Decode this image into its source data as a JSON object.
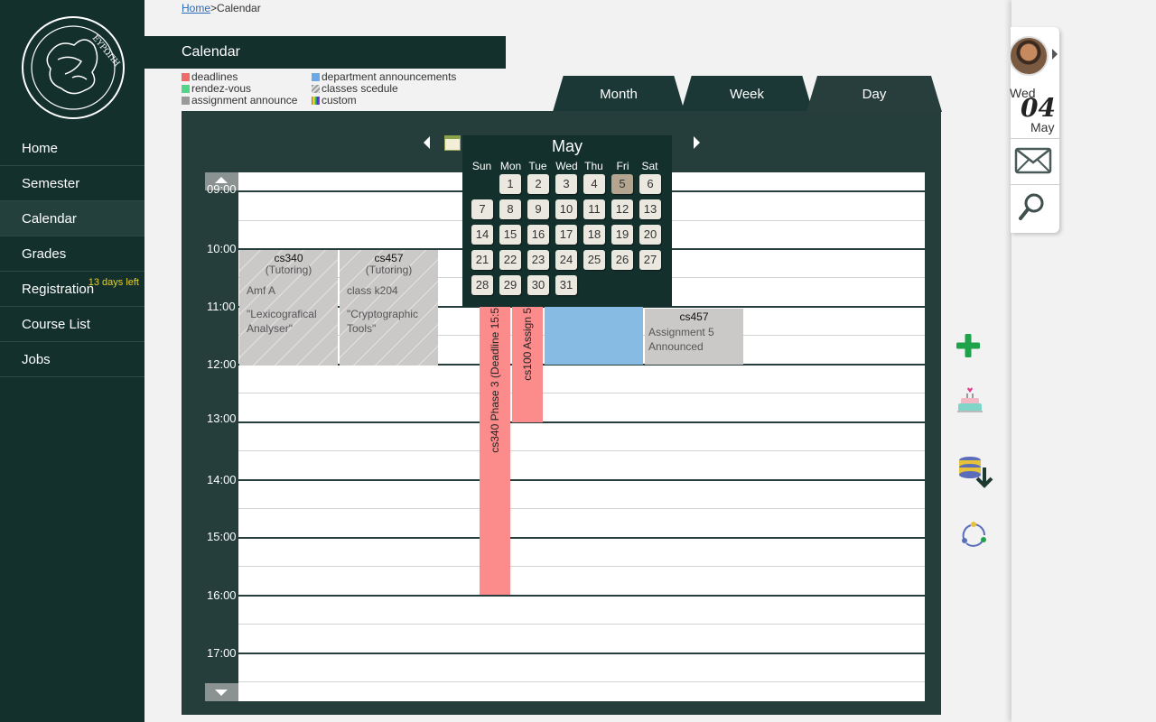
{
  "breadcrumb": {
    "home": "Home",
    "separator": ">",
    "current": "Calendar"
  },
  "logo": {
    "text": "ΕΥΡΩΠΗ"
  },
  "sidebar": {
    "items": [
      {
        "label": "Home"
      },
      {
        "label": "Semester"
      },
      {
        "label": "Calendar",
        "active": true
      },
      {
        "label": "Grades"
      },
      {
        "label": "Registration",
        "badge": "13 days left"
      },
      {
        "label": "Course List"
      },
      {
        "label": "Jobs"
      }
    ]
  },
  "page_title": "Calendar",
  "legend": [
    {
      "label": "deadlines",
      "color": "#f06a6a"
    },
    {
      "label": "department announcements",
      "color": "#6aa8e8"
    },
    {
      "label": "rendez-vous",
      "color": "#52d48a"
    },
    {
      "label": "classes scedule",
      "color": "hatched-grey"
    },
    {
      "label": "assignment announce",
      "color": "#9a9a9a"
    },
    {
      "label": "custom",
      "color": "rainbow"
    }
  ],
  "tabs": [
    {
      "label": "Month"
    },
    {
      "label": "Week"
    },
    {
      "label": "Day",
      "active": true
    }
  ],
  "hours": [
    "09:00",
    "10:00",
    "11:00",
    "12:00",
    "13:00",
    "14:00",
    "15:00",
    "16:00",
    "17:00"
  ],
  "events": {
    "e1": {
      "title": "cs340",
      "sub": "(Tutoring)",
      "line1": "Amf A",
      "line2": "\"Lexicografical Analyser\""
    },
    "e2": {
      "title": "cs457",
      "sub": "(Tutoring)",
      "line1": "class k204",
      "line2": "\"Cryptographic Tools\""
    },
    "e3": {
      "text": "cs340 Phase 3 (Deadline 15:5"
    },
    "e4": {
      "text": "cs100 Assign 5"
    },
    "e5": {
      "title": "cs457",
      "line1": "Assignment 5 Announced"
    }
  },
  "month_picker": {
    "month": "May",
    "weekdays": [
      "Sun",
      "Mon",
      "Tue",
      "Wed",
      "Thu",
      "Fri",
      "Sat"
    ],
    "today": "5",
    "weeks": [
      [
        "",
        "1",
        "2",
        "3",
        "4",
        "5",
        "6"
      ],
      [
        "7",
        "8",
        "9",
        "10",
        "11",
        "12",
        "13"
      ],
      [
        "14",
        "15",
        "16",
        "17",
        "18",
        "19",
        "20"
      ],
      [
        "21",
        "22",
        "23",
        "24",
        "25",
        "26",
        "27"
      ],
      [
        "28",
        "29",
        "30",
        "31",
        "",
        "",
        ""
      ]
    ]
  },
  "date_widget": {
    "weekday": "Wed",
    "day": "04",
    "month": "May"
  },
  "icons": {
    "avatar": "user-avatar",
    "mail": "mail-icon",
    "search": "search-icon",
    "add": "add-icon",
    "cake": "cake-icon",
    "database": "database-download-icon",
    "sync": "sync-icon",
    "calendar": "calendar-icon"
  }
}
